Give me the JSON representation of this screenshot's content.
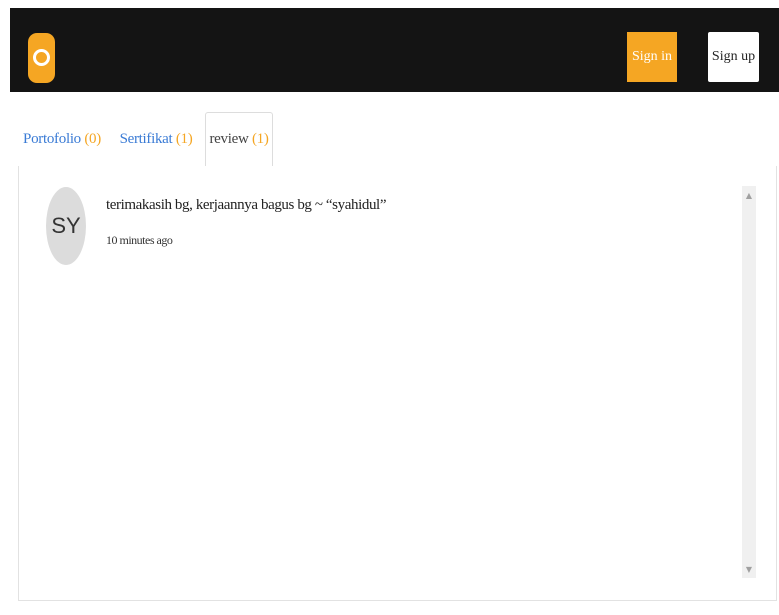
{
  "header": {
    "signin_label": "Sign in",
    "signup_label": "Sign up",
    "logo_icon": "circle-logo-icon",
    "accent_color": "#f5a623",
    "background_color": "#141414"
  },
  "tabs": [
    {
      "label": "Portofolio",
      "count": "(0)",
      "active": false
    },
    {
      "label": "Sertifikat",
      "count": "(1)",
      "active": false
    },
    {
      "label": "review",
      "count": "(1)",
      "active": true
    }
  ],
  "reviews": [
    {
      "initials": "SY",
      "text": "terimakasih bg, kerjaannya bagus bg ~ “syahidul”",
      "time": "10 minutes ago"
    }
  ]
}
